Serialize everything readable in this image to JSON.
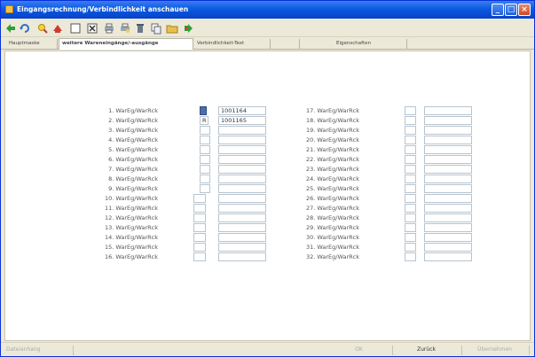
{
  "window": {
    "title": "Eingangsrechnung/Verbindlichkeit anschauen"
  },
  "toolbar": {
    "icons": [
      "back-arrow-icon",
      "refresh-icon",
      "search-icon",
      "bookmark-icon",
      "blank-page-icon",
      "delete-icon",
      "print-icon",
      "print-preview-icon",
      "trash-icon",
      "copy-icon",
      "folder-icon",
      "forward-icon"
    ]
  },
  "tabs": [
    {
      "label": "Hauptmaske",
      "active": false
    },
    {
      "label": "weitere Wareneingänge/-ausgänge",
      "active": true
    },
    {
      "label": "Verbindlichkeit-Text",
      "active": false
    },
    {
      "label": "",
      "active": false
    },
    {
      "label": "Eigenschaften",
      "active": false
    }
  ],
  "left_column": [
    {
      "label": "1. WarEg/WarRck",
      "flag": "",
      "value": "1001164",
      "flag_selected": true
    },
    {
      "label": "2. WarEg/WarRck",
      "flag": "R",
      "value": "1001165",
      "flag_selected": false
    },
    {
      "label": "3. WarEg/WarRck",
      "flag": "",
      "value": ""
    },
    {
      "label": "4. WarEg/WarRck",
      "flag": "",
      "value": ""
    },
    {
      "label": "5. WarEg/WarRck",
      "flag": "",
      "value": ""
    },
    {
      "label": "6. WarEg/WarRck",
      "flag": "",
      "value": ""
    },
    {
      "label": "7. WarEg/WarRck",
      "flag": "",
      "value": ""
    },
    {
      "label": "8. WarEg/WarRck",
      "flag": "",
      "value": ""
    },
    {
      "label": "9. WarEg/WarRck",
      "flag": "",
      "value": ""
    },
    {
      "label": "10. WarEg/WarRck",
      "flag": "",
      "value": ""
    },
    {
      "label": "11. WarEg/WarRck",
      "flag": "",
      "value": ""
    },
    {
      "label": "12. WarEg/WarRck",
      "flag": "",
      "value": ""
    },
    {
      "label": "13. WarEg/WarRck",
      "flag": "",
      "value": ""
    },
    {
      "label": "14. WarEg/WarRck",
      "flag": "",
      "value": ""
    },
    {
      "label": "15. WarEg/WarRck",
      "flag": "",
      "value": ""
    },
    {
      "label": "16. WarEg/WarRck",
      "flag": "",
      "value": ""
    }
  ],
  "right_column": [
    {
      "label": "17. WarEg/WarRck",
      "flag": "",
      "value": ""
    },
    {
      "label": "18. WarEg/WarRck",
      "flag": "",
      "value": ""
    },
    {
      "label": "19. WarEg/WarRck",
      "flag": "",
      "value": ""
    },
    {
      "label": "20. WarEg/WarRck",
      "flag": "",
      "value": ""
    },
    {
      "label": "21. WarEg/WarRck",
      "flag": "",
      "value": ""
    },
    {
      "label": "22. WarEg/WarRck",
      "flag": "",
      "value": ""
    },
    {
      "label": "23. WarEg/WarRck",
      "flag": "",
      "value": ""
    },
    {
      "label": "24. WarEg/WarRck",
      "flag": "",
      "value": ""
    },
    {
      "label": "25. WarEg/WarRck",
      "flag": "",
      "value": ""
    },
    {
      "label": "26. WarEg/WarRck",
      "flag": "",
      "value": ""
    },
    {
      "label": "27. WarEg/WarRck",
      "flag": "",
      "value": ""
    },
    {
      "label": "28. WarEg/WarRck",
      "flag": "",
      "value": ""
    },
    {
      "label": "29. WarEg/WarRck",
      "flag": "",
      "value": ""
    },
    {
      "label": "30. WarEg/WarRck",
      "flag": "",
      "value": ""
    },
    {
      "label": "31. WarEg/WarRck",
      "flag": "",
      "value": ""
    },
    {
      "label": "32. WarEg/WarRck",
      "flag": "",
      "value": ""
    }
  ],
  "statusbar": {
    "buttons": [
      {
        "label": "Dateianhang",
        "enabled": false
      },
      {
        "label": "OK",
        "enabled": false
      },
      {
        "label": "Zurück",
        "enabled": true
      },
      {
        "label": "Übernehmen",
        "enabled": false
      }
    ]
  },
  "colors": {
    "titlebar": "#0a5ae0",
    "selected_flag": "#4c6ea8",
    "field_border": "#b7c4cf"
  }
}
